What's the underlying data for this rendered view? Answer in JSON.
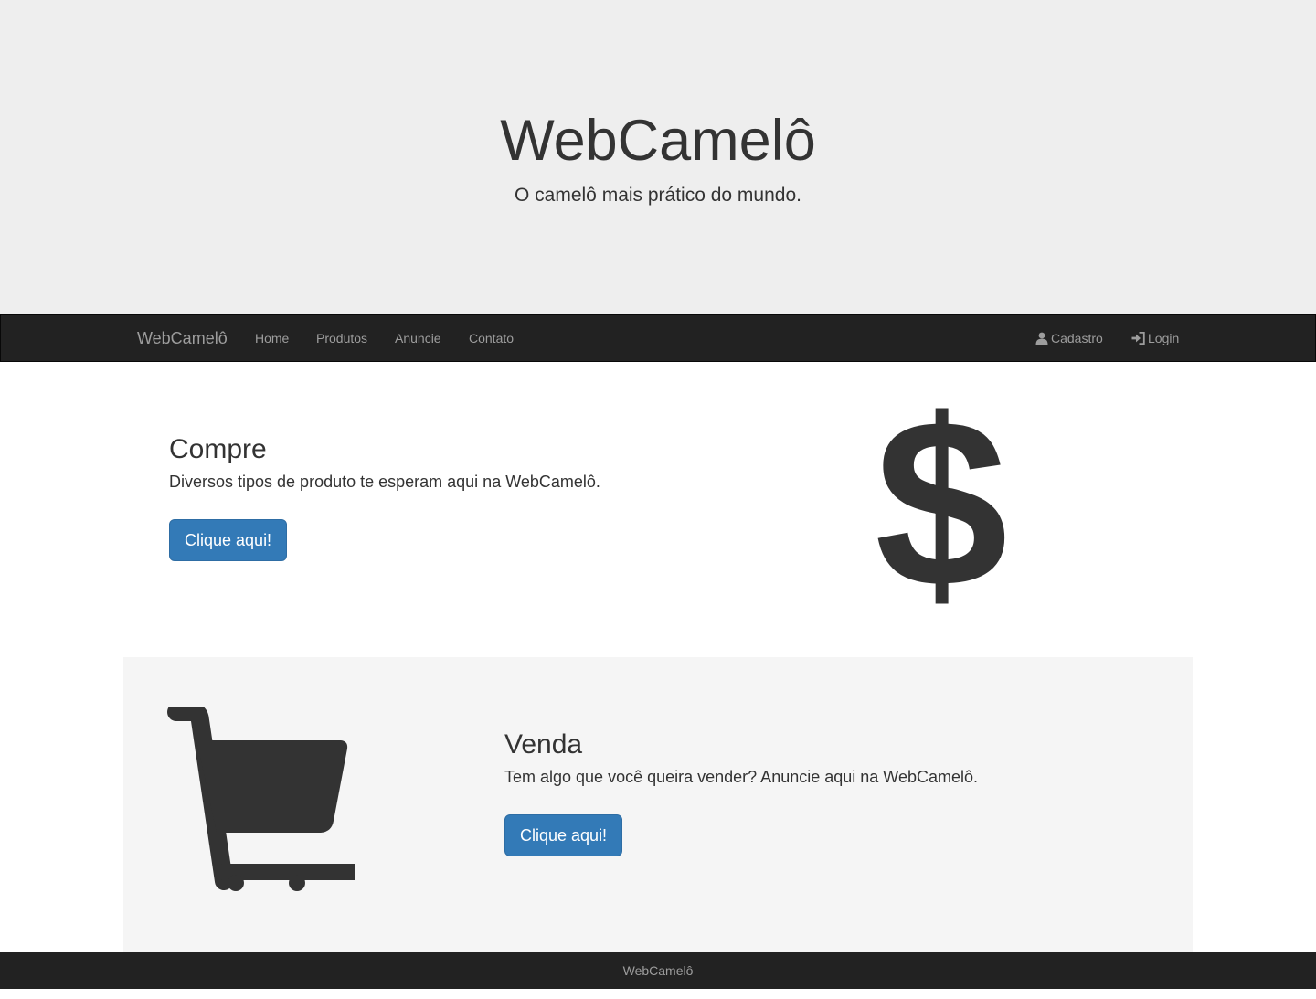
{
  "jumbotron": {
    "title": "WebCamelô",
    "subtitle": "O camelô mais prático do mundo."
  },
  "navbar": {
    "brand": "WebCamelô",
    "links": [
      "Home",
      "Produtos",
      "Anuncie",
      "Contato"
    ],
    "right": {
      "cadastro": "Cadastro",
      "login": "Login"
    },
    "icons": {
      "cadastro": "user-icon",
      "login": "log-in-icon"
    }
  },
  "compre": {
    "title": "Compre",
    "text": "Diversos tipos de produto te esperam aqui na WebCamelô.",
    "button": "Clique aqui!",
    "icon": "dollar-icon",
    "icon_glyph": "$"
  },
  "venda": {
    "title": "Venda",
    "text": "Tem algo que você queira vender? Anuncie aqui na WebCamelô.",
    "button": "Clique aqui!",
    "icon": "shopping-cart-icon"
  },
  "footer": {
    "text": "WebCamelô"
  },
  "colors": {
    "primary": "#337ab7",
    "navbar_bg": "#222222",
    "navbar_text": "#9d9d9d",
    "jumbotron_bg": "#eeeeee",
    "well_bg": "#f5f5f5",
    "text": "#333333"
  }
}
